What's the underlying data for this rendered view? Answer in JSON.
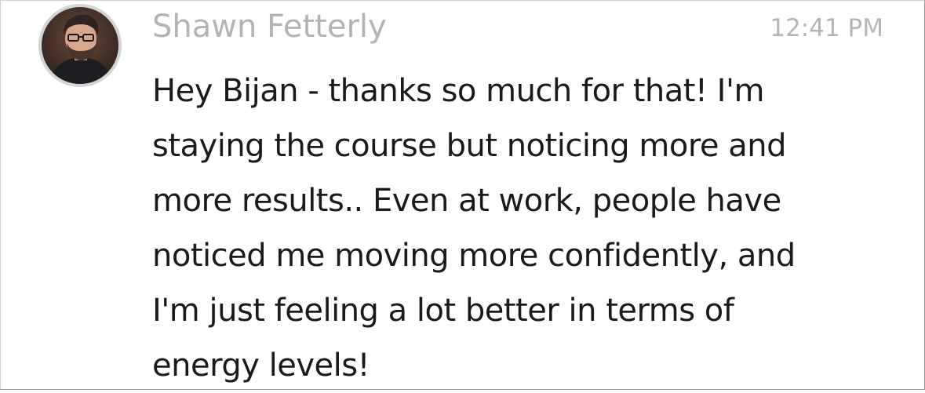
{
  "message": {
    "sender": "Shawn Fetterly",
    "time": "12:41 PM",
    "avatar_icon": "user-avatar-photo",
    "text_lines": [
      "Hey Bijan - thanks so much for that! I'm",
      "staying the course but noticing more and",
      "more results.. Even at work, people have",
      "noticed me moving more confidently, and",
      "I'm just feeling a lot better in terms of",
      "energy levels!"
    ]
  },
  "colors": {
    "sender": "#b3b3b3",
    "timestamp": "#b5b5b5",
    "text": "#1a1a1a",
    "avatar_ring": "#d4d4d4"
  }
}
